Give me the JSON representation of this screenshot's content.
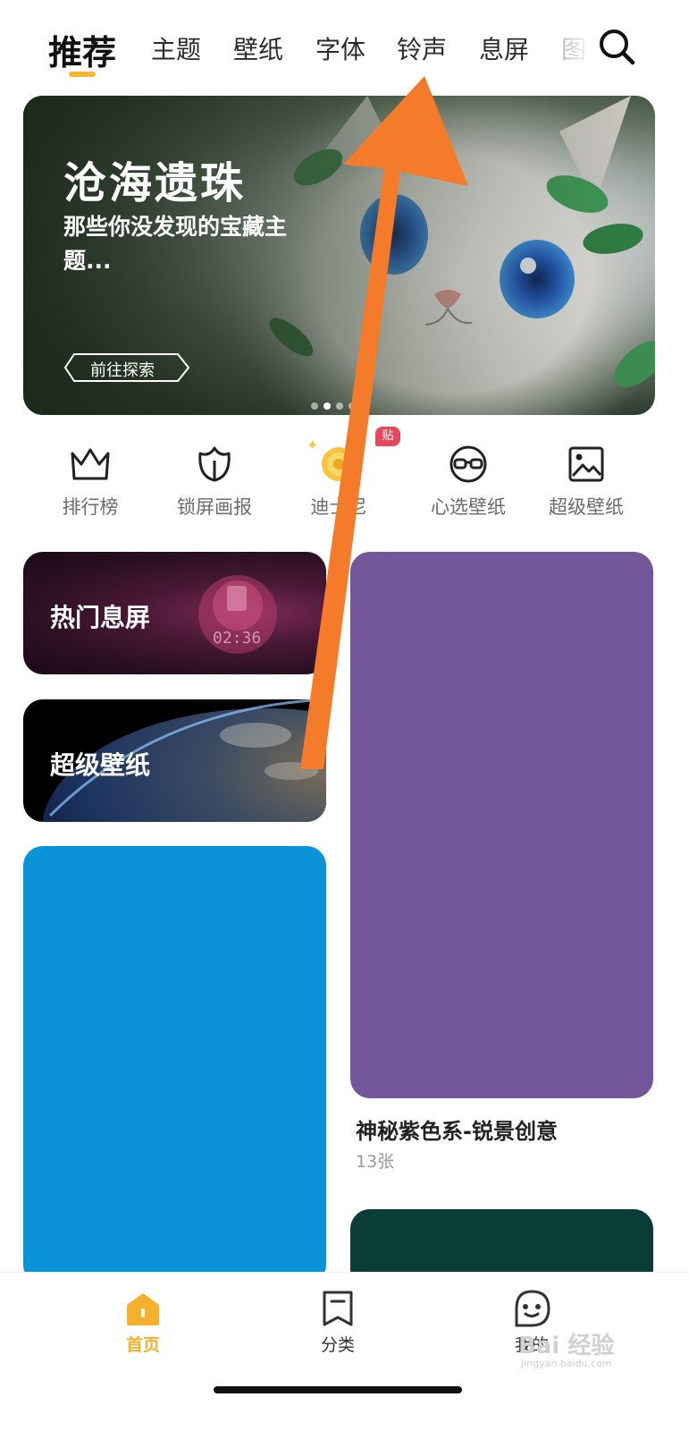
{
  "tabs": {
    "items": [
      {
        "label": "推荐"
      },
      {
        "label": "主题"
      },
      {
        "label": "壁纸"
      },
      {
        "label": "字体"
      },
      {
        "label": "铃声"
      },
      {
        "label": "息屏"
      },
      {
        "label": "图"
      }
    ],
    "active_index": 0,
    "active_color": "#f7b731"
  },
  "banner": {
    "title": "沧海遗珠",
    "subtitle": "那些你没发现的宝藏主题...",
    "button_label": "前往探索",
    "page_count": 4,
    "active_page": 1
  },
  "quick_entries": [
    {
      "label": "排行榜",
      "icon": "crown-icon"
    },
    {
      "label": "锁屏画报",
      "icon": "tulip-icon"
    },
    {
      "label": "迪士尼",
      "icon": "coin-icon",
      "badge": "贴"
    },
    {
      "label": "心选壁纸",
      "icon": "glasses-icon"
    },
    {
      "label": "超级壁纸",
      "icon": "picture-icon"
    }
  ],
  "cards": {
    "hot_aod": {
      "label": "热门息屏",
      "clock": "02:36"
    },
    "super_wallpaper": {
      "label": "超级壁纸"
    },
    "purple": {
      "title": "神秘紫色系-锐景创意",
      "count": "13张",
      "color": "#74569a"
    },
    "blue_color": "#0a93d6",
    "green_color": "#0b3d38"
  },
  "bottom_nav": {
    "items": [
      {
        "label": "首页",
        "icon": "home-icon",
        "active": true
      },
      {
        "label": "分类",
        "icon": "bookmark-icon",
        "active": false
      },
      {
        "label": "我的",
        "icon": "smiley-icon",
        "active": false
      }
    ]
  },
  "watermark": {
    "text": "Bai 经验",
    "sub": "jingyan.baidu.com"
  },
  "annotation": {
    "arrow_color": "#f47b2a"
  }
}
